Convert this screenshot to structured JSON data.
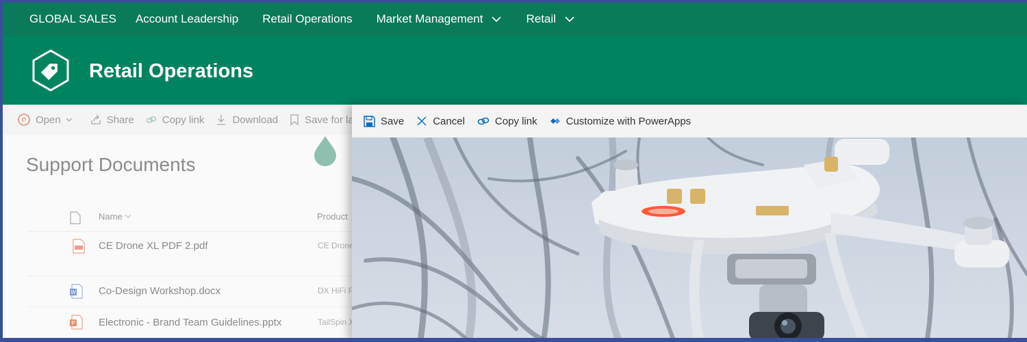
{
  "topnav": {
    "items": [
      {
        "label": "GLOBAL SALES",
        "dropdown": false
      },
      {
        "label": "Account Leadership",
        "dropdown": false
      },
      {
        "label": "Retail Operations",
        "dropdown": false
      },
      {
        "label": "Market Management",
        "dropdown": true
      },
      {
        "label": "Retail",
        "dropdown": true
      }
    ]
  },
  "site": {
    "title": "Retail Operations",
    "icon": "tag-icon"
  },
  "list_commands": {
    "open": "Open",
    "share": "Share",
    "copy_link": "Copy link",
    "download": "Download",
    "save_for_later": "Save for lat"
  },
  "library": {
    "title": "Support Documents",
    "columns": {
      "name": "Name",
      "product": "Product"
    },
    "rows": [
      {
        "name": "CE Drone XL PDF 2.pdf",
        "product": "CE Drone",
        "type": "pdf"
      },
      {
        "name": "Co-Design Workshop.docx",
        "product": "DX HiFi P",
        "type": "docx"
      },
      {
        "name": "Electronic - Brand Team Guidelines.pptx",
        "product": "TailSpin X",
        "type": "pptx"
      }
    ]
  },
  "panel_commands": {
    "save": "Save",
    "cancel": "Cancel",
    "copy_link": "Copy link",
    "customize": "Customize with PowerApps"
  },
  "colors": {
    "nav_green": "#0b7a58",
    "header_green": "#00835f",
    "frame_blue": "#3a4f9a",
    "accent_blue": "#0f6cbd"
  }
}
